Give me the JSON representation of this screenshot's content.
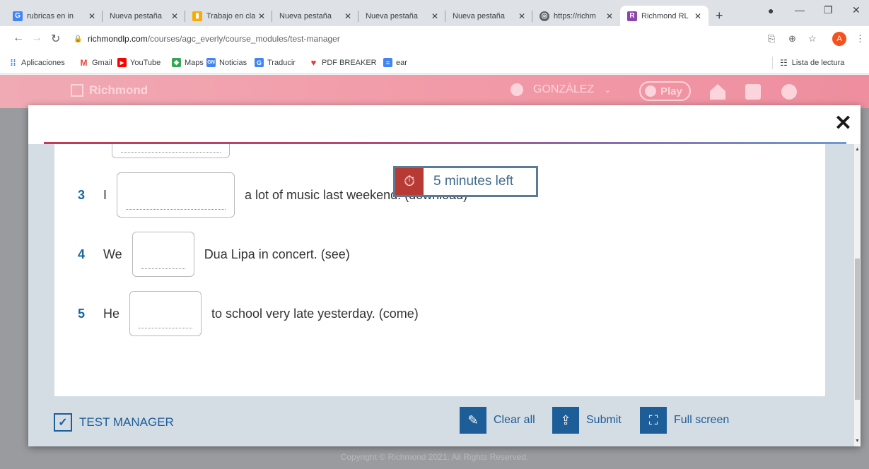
{
  "browser": {
    "tabs": [
      {
        "title": "rubricas en in",
        "icon": "google-icon",
        "active": false
      },
      {
        "title": "Nueva pestaña",
        "icon": "",
        "active": false
      },
      {
        "title": "Trabajo en cla",
        "icon": "classroom-icon",
        "active": false
      },
      {
        "title": "Nueva pestaña",
        "icon": "",
        "active": false
      },
      {
        "title": "Nueva pestaña",
        "icon": "",
        "active": false
      },
      {
        "title": "Nueva pestaña",
        "icon": "",
        "active": false
      },
      {
        "title": "https://richm",
        "icon": "globe-icon",
        "active": false
      },
      {
        "title": "Richmond RL",
        "icon": "richmond-icon",
        "active": true
      }
    ],
    "tab_close_glyph": "✕",
    "new_tab_glyph": "+",
    "url_host": "richmondlp.com",
    "url_path": "/courses/agc_everly/course_modules/test-manager",
    "profile_initial": "A",
    "bookmarks": [
      {
        "label": "Aplicaciones",
        "icon": "apps-icon",
        "color": "#1a73e8"
      },
      {
        "label": "Gmail",
        "icon": "gmail-icon",
        "color": "#ea4335"
      },
      {
        "label": "YouTube",
        "icon": "youtube-icon",
        "color": "#ff0000"
      },
      {
        "label": "Maps",
        "icon": "maps-icon",
        "color": "#34a853"
      },
      {
        "label": "Noticias",
        "icon": "news-icon",
        "color": "#4285f4"
      },
      {
        "label": "Traducir",
        "icon": "translate-icon",
        "color": "#4285f4"
      },
      {
        "label": "PDF BREAKER",
        "icon": "heart-icon",
        "color": "#e53935"
      },
      {
        "label": "ear",
        "icon": "docs-icon",
        "color": "#4285f4"
      }
    ],
    "reading_list": "Lista de lectura"
  },
  "site": {
    "logo": "Richmond",
    "user": "GONZÁLEZ",
    "play": "Play",
    "footer": "Copyright © Richmond 2021. All Rights Reserved."
  },
  "exercise": {
    "questions": [
      {
        "num": "3",
        "prefix": "I",
        "text": "a lot of music last weekend. (download)"
      },
      {
        "num": "4",
        "prefix": "We",
        "text": "Dua Lipa in concert. (see)"
      },
      {
        "num": "5",
        "prefix": "He",
        "text": "to school very late yesterday. (come)"
      }
    ],
    "timer": "5 minutes left"
  },
  "footer_bar": {
    "brand": "TEST MANAGER",
    "clear_all": "Clear all",
    "submit": "Submit",
    "full_screen": "Full screen"
  },
  "colors": {
    "accent": "#1d5e99",
    "question_number": "#1565a8",
    "timer_icon_bg": "#b73a35"
  }
}
